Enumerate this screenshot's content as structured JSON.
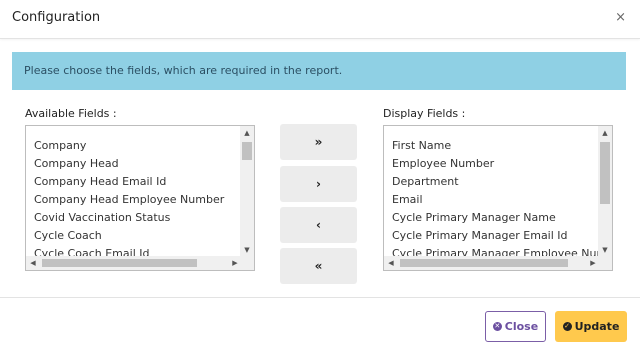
{
  "dialog": {
    "title": "Configuration",
    "close_symbol": "×"
  },
  "info": {
    "message": "Please choose the fields, which are required in the report."
  },
  "available": {
    "label": "Available Fields :",
    "items": [
      "Company",
      "Company Head",
      "Company Head Email Id",
      "Company Head Employee Number",
      "Covid Vaccination Status",
      "Cycle Coach",
      "Cycle Coach Email Id"
    ]
  },
  "display": {
    "label": "Display Fields :",
    "items": [
      "First Name",
      "Employee Number",
      "Department",
      "Email",
      "Cycle Primary Manager Name",
      "Cycle Primary Manager Email Id",
      "Cycle Primary Manager Employee Number"
    ]
  },
  "move_buttons": {
    "add_all": "»",
    "add": "›",
    "remove": "‹",
    "remove_all": "«"
  },
  "footer": {
    "close_label": "Close",
    "update_label": "Update"
  },
  "icons": {
    "close": "times-circle-icon",
    "update": "check-circle-icon"
  },
  "colors": {
    "info_bg": "#8fd0e4",
    "update_bg": "#ffc94d",
    "close_border": "#7b5ea7"
  }
}
